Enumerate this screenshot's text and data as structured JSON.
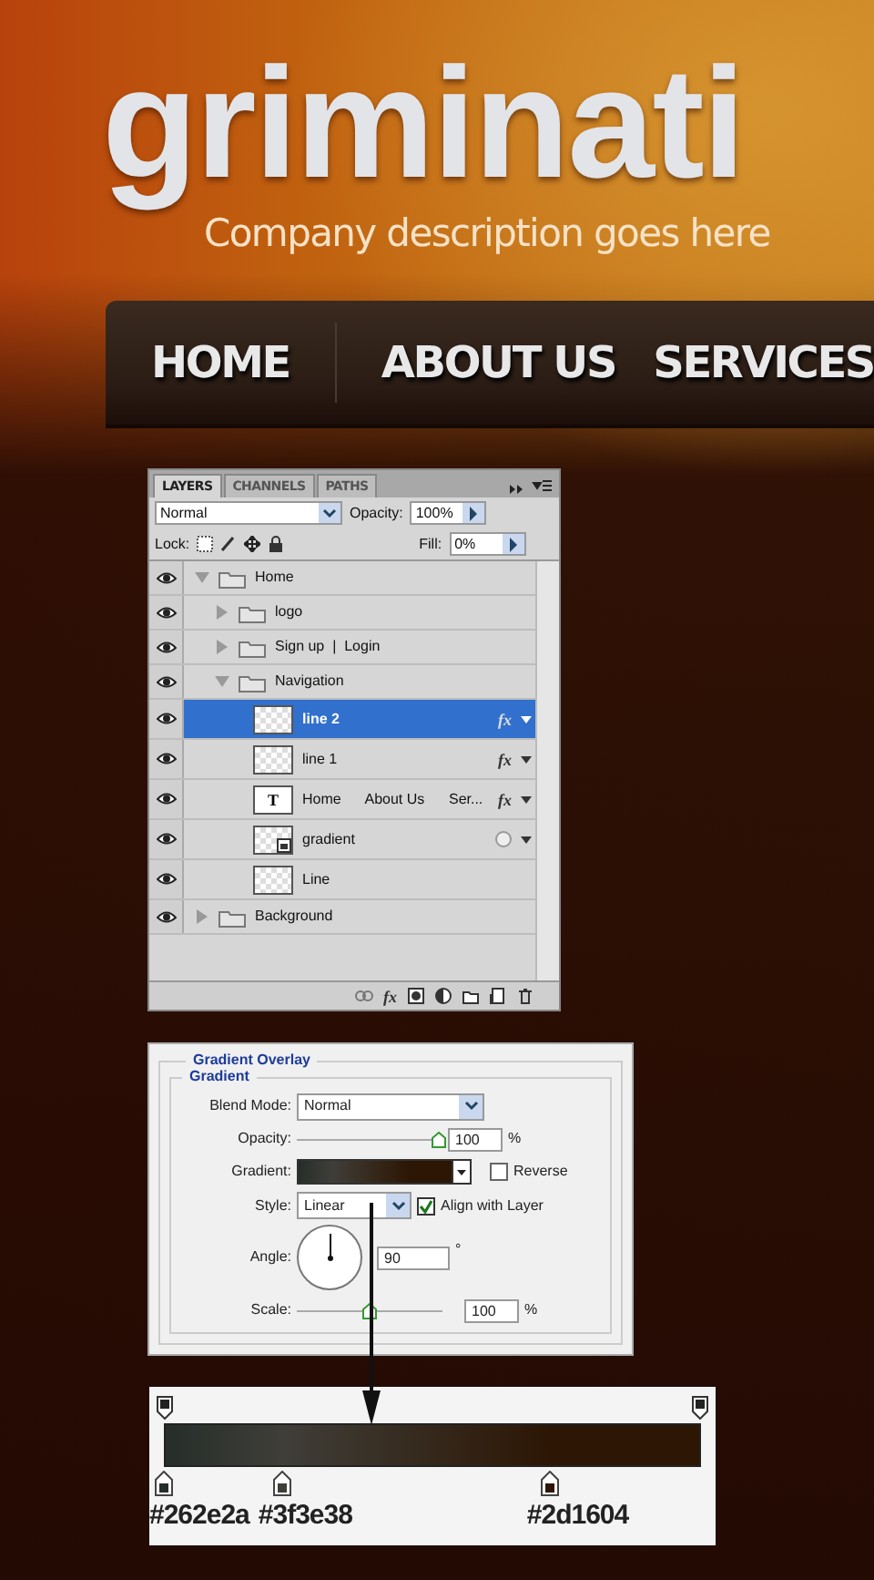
{
  "header": {
    "logo": "griminati",
    "tagline": "Company description goes here"
  },
  "nav": {
    "items": [
      {
        "label": "HOME"
      },
      {
        "label": "ABOUT US"
      },
      {
        "label": "SERVICES"
      }
    ]
  },
  "layers_panel": {
    "tabs": [
      {
        "label": "LAYERS",
        "selected": true
      },
      {
        "label": "CHANNELS",
        "selected": false
      },
      {
        "label": "PATHS",
        "selected": false
      }
    ],
    "blend_mode": "Normal",
    "opacity_label": "Opacity:",
    "opacity": "100%",
    "lock_label": "Lock:",
    "fill_label": "Fill:",
    "fill": "0%",
    "layers": [
      {
        "name": "Home",
        "kind": "group",
        "visible": true,
        "expanded": true,
        "selected": false,
        "children": [
          {
            "name": "logo",
            "kind": "group",
            "visible": true,
            "expanded": false,
            "selected": false
          },
          {
            "name": "Sign up  |  Login",
            "kind": "group",
            "visible": true,
            "expanded": false,
            "selected": false
          },
          {
            "name": "Navigation",
            "kind": "group",
            "visible": true,
            "expanded": true,
            "selected": false,
            "children": [
              {
                "name": "line 2",
                "kind": "layer",
                "visible": true,
                "selected": true,
                "effects": "fx"
              },
              {
                "name": "line 1",
                "kind": "layer",
                "visible": true,
                "selected": false,
                "effects": "fx"
              },
              {
                "name": "Home      About Us      Ser...",
                "kind": "text",
                "visible": true,
                "selected": false,
                "effects": "fx",
                "thumb": "T"
              },
              {
                "name": "gradient",
                "kind": "smart",
                "visible": true,
                "selected": false
              },
              {
                "name": "Line",
                "kind": "layer",
                "visible": true,
                "selected": false
              }
            ]
          }
        ]
      },
      {
        "name": "Background",
        "kind": "group",
        "visible": true,
        "expanded": false,
        "selected": false
      }
    ],
    "footer_effects": "fx"
  },
  "gradient_overlay": {
    "title": "Gradient Overlay",
    "section": "Gradient",
    "blend_mode": {
      "label": "Blend Mode:",
      "value": "Normal"
    },
    "opacity": {
      "label": "Opacity:",
      "level": 0.97,
      "value": "100",
      "unit": "%"
    },
    "gradient": {
      "label": "Gradient:",
      "reverse": {
        "label": "Reverse",
        "checked": false
      }
    },
    "style": {
      "label": "Style:",
      "value": "Linear",
      "align": {
        "label": "Align with Layer",
        "checked": true
      }
    },
    "angle": {
      "label": "Angle:",
      "value": "90",
      "unit": "°"
    },
    "scale": {
      "label": "Scale:",
      "level": 0.5,
      "value": "100",
      "unit": "%"
    }
  },
  "gradient_editor": {
    "stops": [
      {
        "label": "#262e2a",
        "color": "#262e2a",
        "level": 0
      },
      {
        "label": "#3f3e38",
        "color": "#3f3e38",
        "level": 0.22
      },
      {
        "label": "#2d1604",
        "color": "#2d1604",
        "level": 0.72
      }
    ]
  }
}
